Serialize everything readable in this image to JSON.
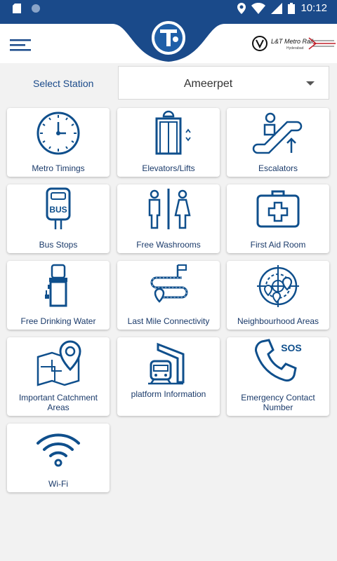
{
  "status_bar": {
    "time": "10:12"
  },
  "header": {
    "menu_icon": "hamburger-menu-icon",
    "logo": "metro-logo",
    "partner_logo_text": "L&T Metro Rail",
    "partner_logo_sub": "Hyderabad"
  },
  "station": {
    "label": "Select Station",
    "selected": "Ameerpet"
  },
  "tiles": [
    {
      "label": "Metro Timings",
      "icon": "clock-icon"
    },
    {
      "label": "Elevators/Lifts",
      "icon": "elevator-icon"
    },
    {
      "label": "Escalators",
      "icon": "escalator-icon"
    },
    {
      "label": "Bus Stops",
      "icon": "bus-stop-icon"
    },
    {
      "label": "Free Washrooms",
      "icon": "washroom-icon"
    },
    {
      "label": "First Aid Room",
      "icon": "first-aid-icon"
    },
    {
      "label": "Free Drinking Water",
      "icon": "water-dispenser-icon"
    },
    {
      "label": "Last Mile Connectivity",
      "icon": "route-icon"
    },
    {
      "label": "Neighbourhood Areas",
      "icon": "radar-map-icon"
    },
    {
      "label": "Important Catchment",
      "label2": "Areas",
      "icon": "map-pin-icon"
    },
    {
      "label": "platform Information",
      "icon": "train-platform-icon"
    },
    {
      "label": "Emergency Contact",
      "label2": "Number",
      "icon": "sos-phone-icon"
    },
    {
      "label": "Wi-Fi",
      "icon": "wifi-icon"
    }
  ],
  "colors": {
    "primary": "#1a4a8a",
    "icon": "#0f4f8c",
    "background": "#f2f2f2"
  }
}
